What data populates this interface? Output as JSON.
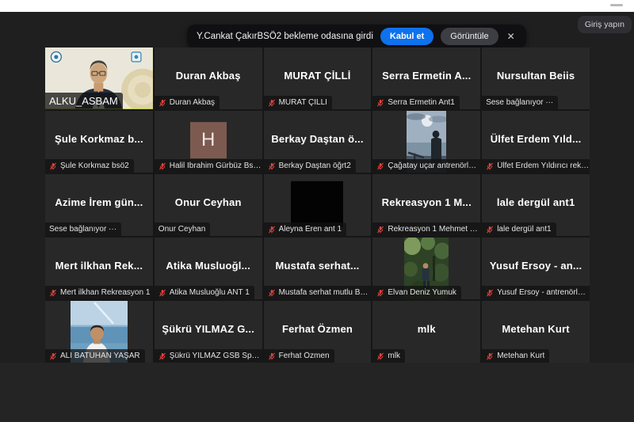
{
  "header": {
    "sign_in_label": "Giriş yapın"
  },
  "toast": {
    "message": "Y.Cankat ÇakırBSÖ2 bekleme odasına girdi",
    "accept_label": "Kabul et",
    "view_label": "Görüntüle",
    "close_label": "✕"
  },
  "colors": {
    "page_bg": "#1f1f1f",
    "tile_bg": "#282828",
    "active_speaker_border": "#bdd23c",
    "accept_button": "#0e72ed",
    "view_button": "#3d3d44",
    "muted_mic": "#e0443f",
    "toast_bg": "#101013"
  },
  "participants": [
    {
      "type": "video",
      "scene": "office",
      "label": "ALKU_ASBAM",
      "muted": false,
      "active": true,
      "label_large": true
    },
    {
      "type": "name",
      "center": "Duran Akbaş",
      "label": "Duran Akbaş",
      "muted": true
    },
    {
      "type": "name",
      "center": "MURAT ÇİLLİ",
      "label": "MURAT ÇİLLİ",
      "muted": true
    },
    {
      "type": "name",
      "center": "Serra Ermetin A...",
      "label": "Serra Ermetin Ant1",
      "muted": true
    },
    {
      "type": "name",
      "center": "Nursultan Beiis",
      "label": "Sese bağlanıyor ···",
      "muted": false
    },
    {
      "type": "name",
      "center": "Şule Korkmaz b...",
      "label": "Şule Korkmaz bsö2",
      "muted": true
    },
    {
      "type": "avatar",
      "initial": "H",
      "label": "Halil İbrahim Gürbüz Bsö2 ...",
      "muted": true
    },
    {
      "type": "name",
      "center": "Berkay Daştan ö...",
      "label": "Berkay Daştan öğrt2",
      "muted": true
    },
    {
      "type": "photo",
      "scene": "sea",
      "label": "Çağatay uçar antrenörlük 1.",
      "muted": true
    },
    {
      "type": "name",
      "center": "Ülfet Erdem Yıld...",
      "label": "Ülfet Erdem Yıldırıcı rekrea...",
      "muted": true
    },
    {
      "type": "name",
      "center": "Azime İrem gün...",
      "label": "Sese bağlanıyor ···",
      "muted": false
    },
    {
      "type": "name",
      "center": "Onur Ceyhan",
      "label": "Onur Ceyhan",
      "muted": false
    },
    {
      "type": "black",
      "label": "Aleyna Eren ant 1",
      "muted": true
    },
    {
      "type": "name",
      "center": "Rekreasyon 1 M...",
      "label": "Rekreasyon 1 Mehmet Emi...",
      "muted": true
    },
    {
      "type": "name",
      "center": "lale dergül ant1",
      "label": "lale dergül ant1",
      "muted": true
    },
    {
      "type": "name",
      "center": "Mert ilkhan Rek...",
      "label": "Mert ilkhan Rekreasyon 1",
      "muted": true
    },
    {
      "type": "name",
      "center": "Atika Musluoğl...",
      "label": "Atika Musluoğlu ANT 1",
      "muted": true
    },
    {
      "type": "name",
      "center": "Mustafa serhat...",
      "label": "Mustafa serhat mutlu BSÖ 2",
      "muted": true
    },
    {
      "type": "photo",
      "scene": "forest",
      "label": "Elvan Deniz Yumuk",
      "muted": true
    },
    {
      "type": "name",
      "center": "Yusuf Ersoy - an...",
      "label": "Yusuf Ersoy - antrenörlük 1",
      "muted": true
    },
    {
      "type": "photo",
      "scene": "beach",
      "label": "ALİ BATUHAN YAŞAR",
      "muted": true
    },
    {
      "type": "name",
      "center": "Şükrü YILMAZ G...",
      "label": "Şükrü YILMAZ GSB Spor Eğ...",
      "muted": true
    },
    {
      "type": "name",
      "center": "Ferhat Özmen",
      "label": "Ferhat Özmen",
      "muted": true
    },
    {
      "type": "name",
      "center": "mlk",
      "label": "mlk",
      "muted": true
    },
    {
      "type": "name",
      "center": "Metehan Kurt",
      "label": "Metehan Kurt",
      "muted": true
    }
  ]
}
